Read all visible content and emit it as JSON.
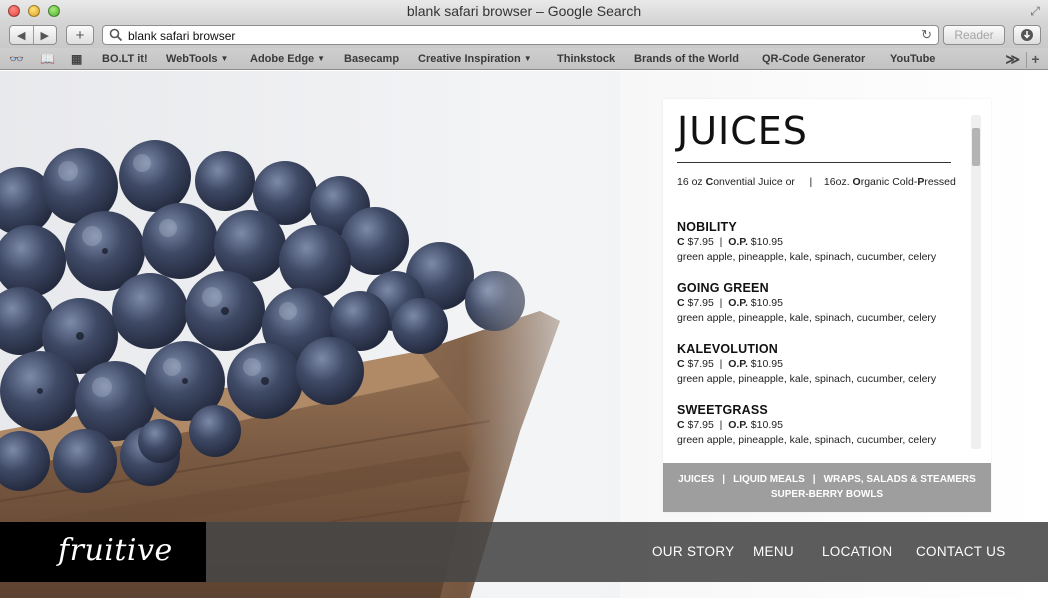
{
  "window": {
    "title": "blank safari browser – Google Search"
  },
  "toolbar": {
    "back_label": "◀",
    "forward_label": "▶",
    "add_label": "+",
    "url": "blank safari browser",
    "reader_label": "Reader",
    "reload_glyph": "↻"
  },
  "bookmarks": {
    "items": [
      {
        "label": "BO.LT it!",
        "caret": ""
      },
      {
        "label": "WebTools",
        "caret": "▼"
      },
      {
        "label": "Adobe Edge",
        "caret": "▼"
      },
      {
        "label": "Basecamp",
        "caret": ""
      },
      {
        "label": "Creative Inspiration",
        "caret": "▼"
      },
      {
        "label": "Thinkstock",
        "caret": ""
      },
      {
        "label": "Brands of the World",
        "caret": ""
      },
      {
        "label": "QR-Code Generator",
        "caret": ""
      },
      {
        "label": "YouTube",
        "caret": ""
      }
    ],
    "overflow": "≫",
    "new_tab": "+"
  },
  "menu": {
    "title": "JUICES",
    "sizes": {
      "a_prefix": "16 oz ",
      "a_letter": "C",
      "a_rest": "onvential Juice or",
      "separator": "|",
      "b_prefix": "16oz. ",
      "b_letter1": "O",
      "b_mid": "rganic Cold-",
      "b_letter2": "P",
      "b_rest": "ressed"
    },
    "items": [
      {
        "name": "NOBILITY",
        "c_label": "C",
        "c_price": "$7.95",
        "sep": "|",
        "op_label": "O.P.",
        "op_price": "$10.95",
        "ingredients": "green apple, pineapple, kale, spinach, cucumber, celery"
      },
      {
        "name": "GOING GREEN",
        "c_label": "C",
        "c_price": "$7.95",
        "sep": "|",
        "op_label": "O.P.",
        "op_price": "$10.95",
        "ingredients": "green apple, pineapple, kale, spinach, cucumber, celery"
      },
      {
        "name": "KALEVOLUTION",
        "c_label": "C",
        "c_price": "$7.95",
        "sep": "|",
        "op_label": "O.P.",
        "op_price": "$10.95",
        "ingredients": "green apple, pineapple, kale, spinach, cucumber, celery"
      },
      {
        "name": "SWEETGRASS",
        "c_label": "C",
        "c_price": "$7.95",
        "sep": "|",
        "op_label": "O.P.",
        "op_price": "$10.95",
        "ingredients": "green apple, pineapple, kale, spinach, cucumber, celery"
      }
    ],
    "tabs": {
      "juices": "JUICES",
      "liquid_meals": "LIQUID MEALS",
      "wraps": "WRAPS, SALADS & STEAMERS",
      "bowls": "SUPER-BERRY BOWLS",
      "divider": "|"
    }
  },
  "footer": {
    "logo": "fruitive",
    "nav": [
      "OUR STORY",
      "MENU",
      "LOCATION",
      "CONTACT US"
    ]
  },
  "colors": {
    "footer_bg": "#464646",
    "menu_tabs_bg": "#9e9e9e",
    "berry": "#3b4560",
    "basket": "#7a5a42"
  }
}
